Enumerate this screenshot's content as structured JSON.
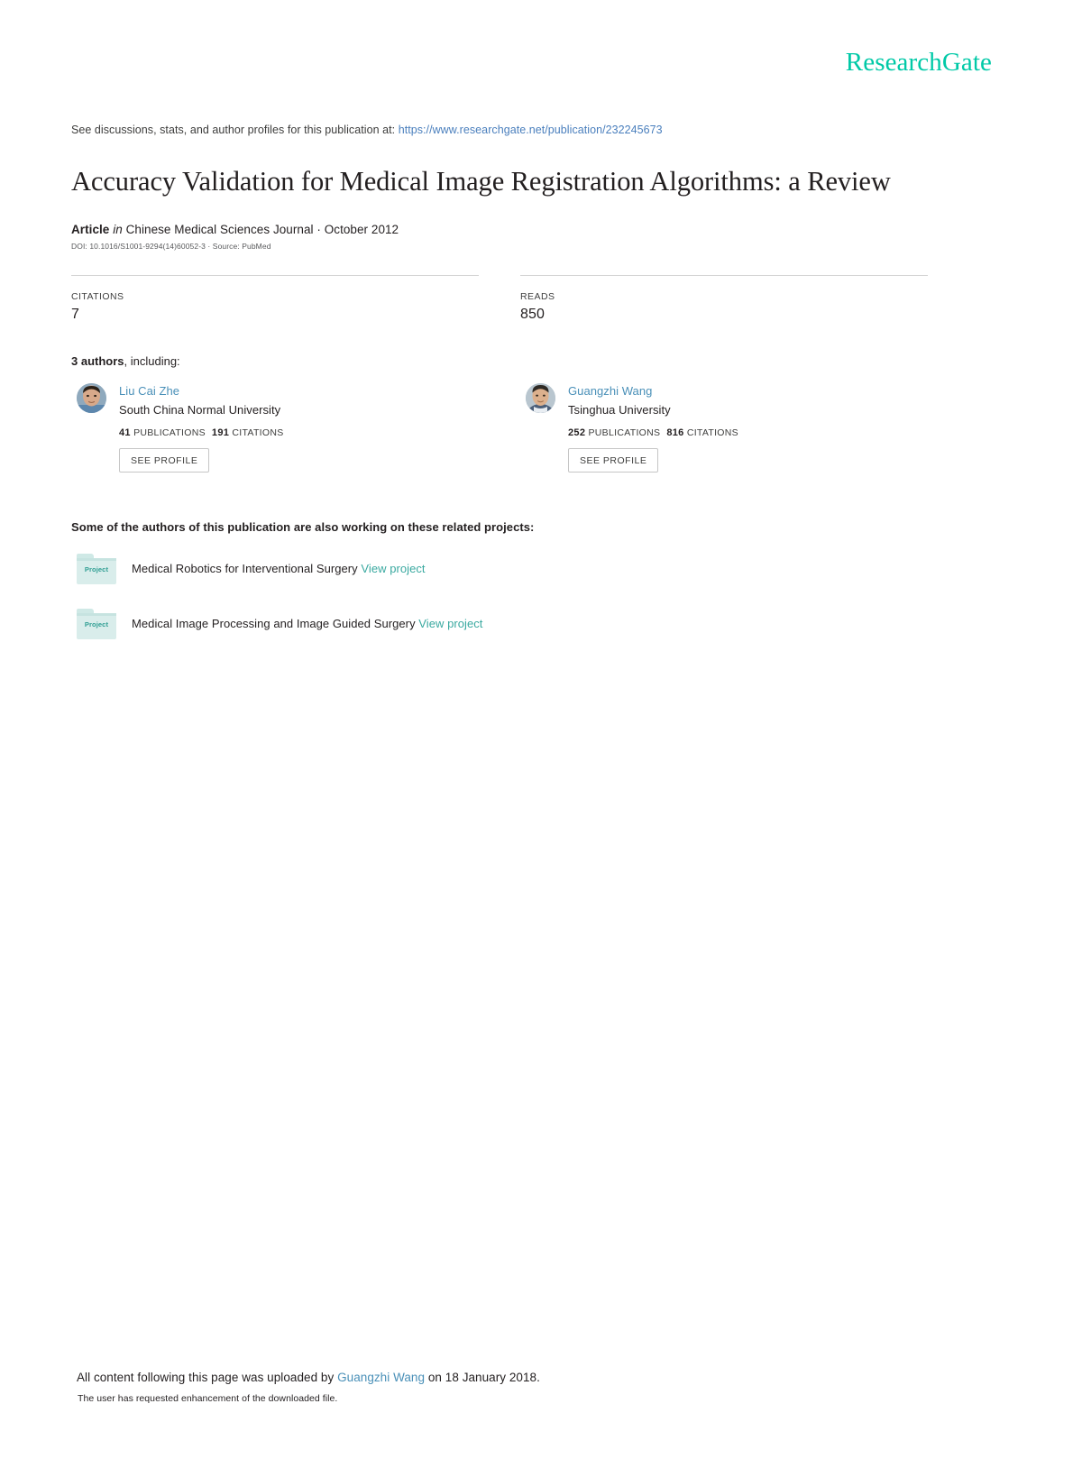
{
  "brand": {
    "logo_text": "ResearchGate",
    "logo_color": "#00c9a7"
  },
  "header": {
    "discussion_prefix": "See discussions, stats, and author profiles for this publication at:",
    "publication_url": "https://www.researchgate.net/publication/232245673",
    "link_color": "#4a7fbd"
  },
  "publication": {
    "title": "Accuracy Validation for Medical Image Registration Algorithms: a Review",
    "type_label": "Article",
    "in_label": "in",
    "venue": "Chinese Medical Sciences Journal · October 2012",
    "doi_line": "DOI: 10.1016/S1001-9294(14)60052-3 · Source: PubMed"
  },
  "metrics": [
    {
      "label": "CITATIONS",
      "value": "7"
    },
    {
      "label": "READS",
      "value": "850"
    }
  ],
  "authors_section": {
    "count_label": "3 authors",
    "including_label": ", including:",
    "authors": [
      {
        "name": "Liu Cai Zhe",
        "affiliation": "South China Normal University",
        "publications_count": "41",
        "publications_label": "PUBLICATIONS",
        "citations_count": "191",
        "citations_label": "CITATIONS",
        "see_profile_label": "SEE PROFILE"
      },
      {
        "name": "Guangzhi Wang",
        "affiliation": "Tsinghua University",
        "publications_count": "252",
        "publications_label": "PUBLICATIONS",
        "citations_count": "816",
        "citations_label": "CITATIONS",
        "see_profile_label": "SEE PROFILE"
      }
    ]
  },
  "projects_section": {
    "heading": "Some of the authors of this publication are also working on these related projects:",
    "projects": [
      {
        "icon_label": "Project",
        "title": "Medical Robotics for Interventional Surgery",
        "view_label": "View project"
      },
      {
        "icon_label": "Project",
        "title": "Medical Image Processing and Image Guided Surgery",
        "view_label": "View project"
      }
    ]
  },
  "footer": {
    "upload_prefix": "All content following this page was uploaded by ",
    "uploader_name": "Guangzhi Wang",
    "upload_suffix": " on 18 January 2018.",
    "enhancement_note": "The user has requested enhancement of the downloaded file."
  }
}
